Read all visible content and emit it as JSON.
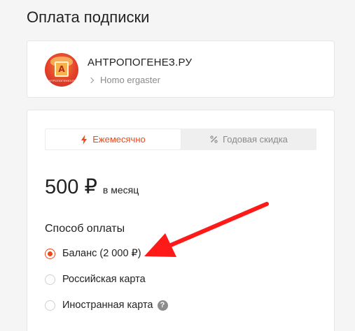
{
  "page": {
    "title": "Оплата подписки"
  },
  "author": {
    "name": "АНТРОПОГЕНЕЗ.РУ",
    "tier": "Homo ergaster",
    "avatar_letter": "A",
    "avatar_caption": "АНТРОПОГЕНЕЗ.РУ"
  },
  "tabs": [
    {
      "label": "Ежемесячно",
      "icon": "lightning-icon",
      "active": true
    },
    {
      "label": "Годовая скидка",
      "icon": "percent-icon",
      "active": false
    }
  ],
  "price": {
    "amount": "500 ₽",
    "period": "в месяц"
  },
  "payment": {
    "title": "Способ оплаты",
    "options": [
      {
        "label": "Баланс (2 000 ₽)",
        "selected": true
      },
      {
        "label": "Российская карта",
        "selected": false
      },
      {
        "label": "Иностранная карта",
        "selected": false,
        "help": "?"
      }
    ]
  },
  "colors": {
    "accent": "#e8491e",
    "annotation_arrow": "#ff1a1a"
  }
}
